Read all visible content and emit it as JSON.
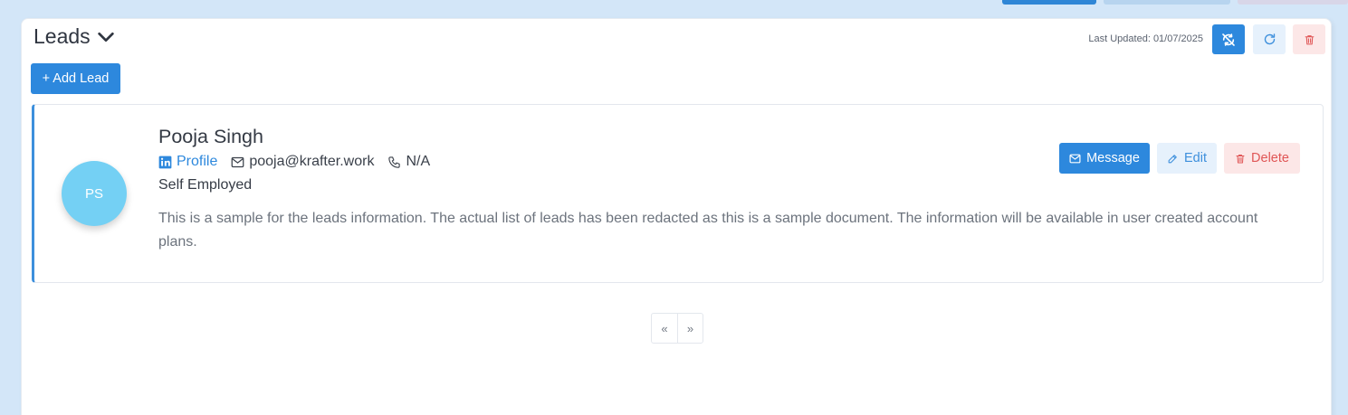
{
  "section": {
    "title": "Leads",
    "last_updated": "Last Updated: 01/07/2025",
    "add_label": "+ Add Lead"
  },
  "lead": {
    "initials": "PS",
    "name": "Pooja Singh",
    "profile_label": "Profile",
    "email": "pooja@krafter.work",
    "phone": "N/A",
    "company": "Self Employed",
    "description": "This is a sample for the leads information. The actual list of leads has been redacted as this is a sample document. The information will be available in user created account plans.",
    "message_label": "Message",
    "edit_label": "Edit",
    "delete_label": "Delete"
  },
  "pagination": {
    "prev": "«",
    "next": "»"
  },
  "colors": {
    "accent": "#2d88dd",
    "danger": "#e05656",
    "avatar": "#74d0f4"
  },
  "icons": [
    "chevron-down-icon",
    "sync-off-icon",
    "refresh-icon",
    "trash-icon",
    "linkedin-icon",
    "mail-icon",
    "phone-icon",
    "pencil-icon"
  ]
}
